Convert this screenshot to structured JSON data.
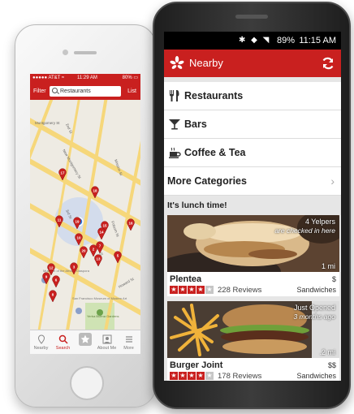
{
  "iphone": {
    "status": {
      "carrier": "●●●●● AT&T ≈",
      "time": "11:29 AM",
      "battery": "80% ▭"
    },
    "filter_label": "Filter",
    "search_value": "Restaurants",
    "list_label": "List",
    "map": {
      "streets": [
        "Montgomery St",
        "2nd St",
        "New Montgomery St",
        "Mission St",
        "3rd St",
        "4th St",
        "Folsom St",
        "Howard St"
      ],
      "pins": [
        "17",
        "18",
        "11",
        "10",
        "16",
        "19",
        "15",
        "14",
        "20",
        "3",
        "7",
        "12",
        "2",
        "5",
        "13",
        "9",
        "6",
        "8"
      ],
      "poi": [
        "Museum of the African Diaspora",
        "San Francisco Museum of Modern Art",
        "Yerba Buena Gardens"
      ]
    },
    "tabs": [
      {
        "label": "Nearby",
        "icon": "nearby-icon",
        "active": false
      },
      {
        "label": "Search",
        "icon": "search-icon",
        "active": true
      },
      {
        "label": "",
        "icon": "star-icon",
        "active": false
      },
      {
        "label": "About Me",
        "icon": "profile-icon",
        "active": false
      },
      {
        "label": "More",
        "icon": "more-icon",
        "active": false
      }
    ]
  },
  "android": {
    "status": {
      "icons": "✱ ◆ ◥",
      "battery": "89%",
      "time": "11:15 AM"
    },
    "title": "Nearby",
    "categories": [
      {
        "label": "Restaurants",
        "icon": "fork-knife-icon"
      },
      {
        "label": "Bars",
        "icon": "martini-icon"
      },
      {
        "label": "Coffee & Tea",
        "icon": "coffee-icon"
      },
      {
        "label": "More Categories",
        "icon": "",
        "chevron": "›"
      }
    ],
    "section_title": "It's lunch time!",
    "cards": [
      {
        "name": "Plentea",
        "price": "$",
        "badge1": "4 Yelpers",
        "badge2": "are checked in here",
        "distance": "1 mi",
        "rating": 4,
        "reviews": "228 Reviews",
        "category": "Sandwiches"
      },
      {
        "name": "Burger Joint",
        "price": "$$",
        "badge1": "Just Opened",
        "badge2": "3 months ago",
        "distance": ".2 mi",
        "rating": 4,
        "reviews": "178 Reviews",
        "category": "Sandwiches"
      }
    ]
  },
  "colors": {
    "accent": "#c9201f",
    "map_bg": "#f0ede6",
    "street": "#f6d77a"
  }
}
